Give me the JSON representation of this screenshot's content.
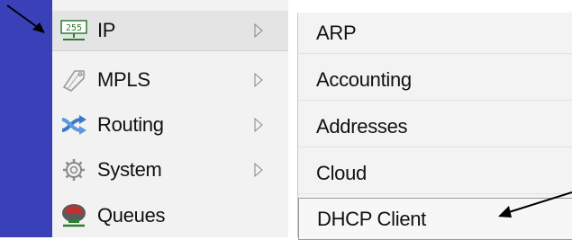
{
  "main_menu": {
    "items": [
      {
        "label": "IP",
        "icon": "ip-network-icon",
        "has_submenu": true
      },
      {
        "label": "MPLS",
        "icon": "mpls-tag-icon",
        "has_submenu": true
      },
      {
        "label": "Routing",
        "icon": "routing-arrows-icon",
        "has_submenu": true
      },
      {
        "label": "System",
        "icon": "system-gear-icon",
        "has_submenu": true
      },
      {
        "label": "Queues",
        "icon": "queues-icon",
        "has_submenu": false
      }
    ]
  },
  "ip_submenu": {
    "items": [
      {
        "label": "ARP"
      },
      {
        "label": "Accounting"
      },
      {
        "label": "Addresses"
      },
      {
        "label": "Cloud"
      },
      {
        "label": "DHCP Client"
      }
    ]
  },
  "colors": {
    "sidebar": "#3a40b8",
    "menu_bg": "#f2f2f2",
    "submenu_bg": "#f3f3f3",
    "annotation_arrow": "#000000"
  }
}
